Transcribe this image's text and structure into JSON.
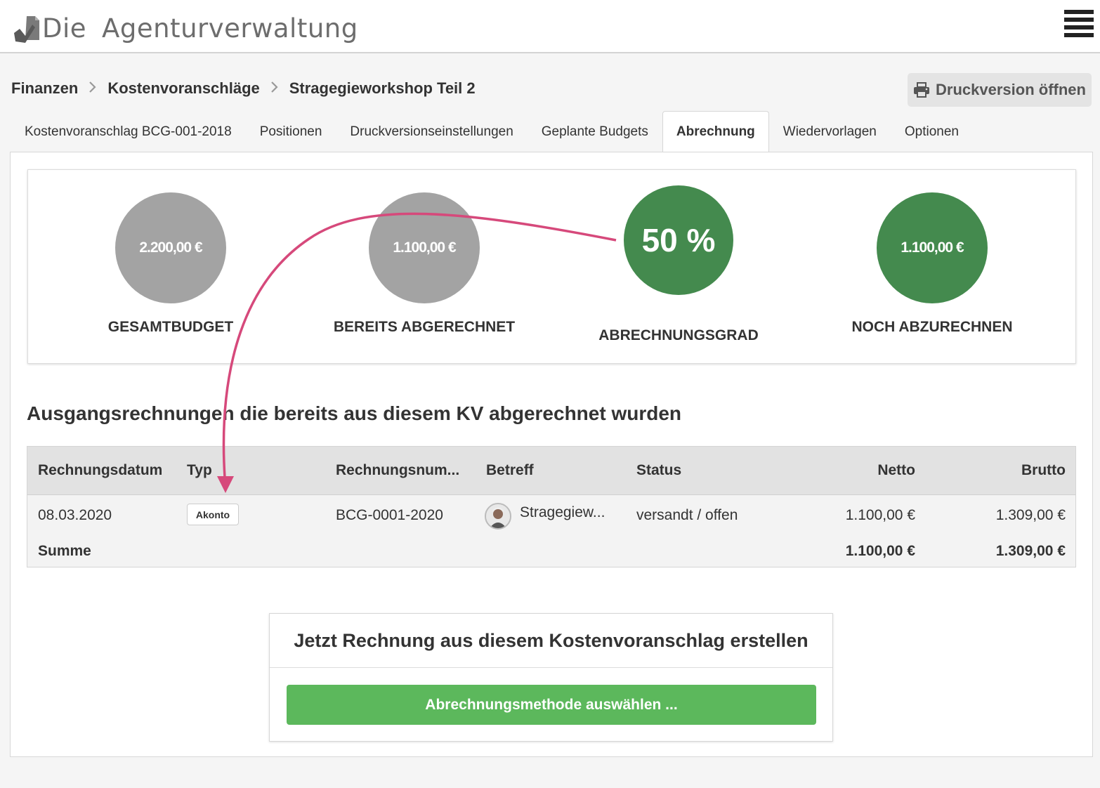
{
  "app": {
    "logo_word1": "Die",
    "logo_word2": "Agenturverwaltung"
  },
  "breadcrumb": {
    "items": [
      "Finanzen",
      "Kostenvoranschläge",
      "Stragegieworkshop Teil 2"
    ],
    "separator": ">"
  },
  "toolbar": {
    "print_label": "Druckversion öffnen"
  },
  "tabs": [
    {
      "label": "Kostenvoranschlag BCG-001-2018",
      "active": false
    },
    {
      "label": "Positionen",
      "active": false
    },
    {
      "label": "Druckversionseinstellungen",
      "active": false
    },
    {
      "label": "Geplante Budgets",
      "active": false
    },
    {
      "label": "Abrechnung",
      "active": true
    },
    {
      "label": "Wiedervorlagen",
      "active": false
    },
    {
      "label": "Optionen",
      "active": false
    }
  ],
  "stats": {
    "total": {
      "value": "2.200,00 €",
      "label": "GESAMTBUDGET"
    },
    "billed": {
      "value": "1.100,00 €",
      "label": "BEREITS ABGERECHNET"
    },
    "degree": {
      "value": "50 %",
      "label": "ABRECHNUNGSGRAD"
    },
    "remaining": {
      "value": "1.100,00 €",
      "label": "NOCH ABZURECHNEN"
    }
  },
  "invoices": {
    "title": "Ausgangsrechnungen die bereits aus diesem KV abgerechnet wurden",
    "columns": {
      "date": "Rechnungsdatum",
      "type": "Typ",
      "number": "Rechnungsnum...",
      "subject": "Betreff",
      "status": "Status",
      "net": "Netto",
      "gross": "Brutto"
    },
    "rows": [
      {
        "date": "08.03.2020",
        "type": "Akonto",
        "number": "BCG-0001-2020",
        "subject": "Stragegiew...",
        "status": "versandt / offen",
        "net": "1.100,00 €",
        "gross": "1.309,00 €"
      }
    ],
    "sum": {
      "label": "Summe",
      "net": "1.100,00 €",
      "gross": "1.309,00 €"
    }
  },
  "create": {
    "title": "Jetzt Rechnung aus diesem Kostenvoranschlag erstellen",
    "button_label": "Abrechnungsmethode auswählen ..."
  },
  "colors": {
    "accent_green": "#5cb85c",
    "stat_green": "#448a4e",
    "stat_gray": "#a3a3a3",
    "annotation_arrow": "#d6497b"
  }
}
